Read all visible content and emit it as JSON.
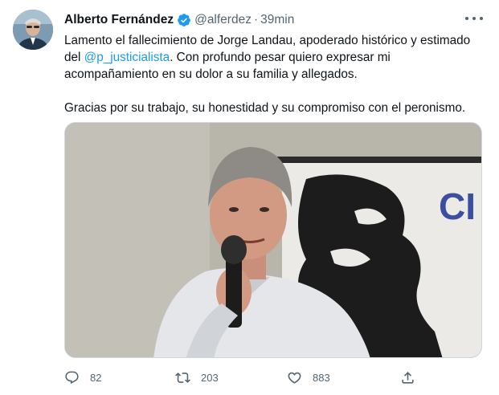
{
  "tweet": {
    "author_name": "Alberto Fernández",
    "handle": "@alferdez",
    "separator": "·",
    "time": "39min",
    "verified": true,
    "text": {
      "line1_part1": "Lamento el fallecimiento de Jorge Landau, apoderado histórico y estimado",
      "line2_prefix": "del ",
      "mention": "@p_justicialista",
      "line2_suffix": ". Con profundo pesar quiero expresar mi",
      "line3": "acompañamiento en su dolor a su familia y allegados.",
      "line4": "Gracias por su trabajo, su honestidad y su compromiso con el peronismo."
    },
    "media": {
      "banner_letters": "CI"
    },
    "actions": {
      "replies": "82",
      "retweets": "203",
      "likes": "883"
    }
  },
  "icons": {
    "verified": "verified-badge-icon",
    "more": "more-options-icon",
    "reply": "reply-icon",
    "retweet": "retweet-icon",
    "like": "heart-icon",
    "share": "share-icon"
  },
  "colors": {
    "accent": "#1d9bf0",
    "text": "#0f1419",
    "muted": "#536471"
  }
}
